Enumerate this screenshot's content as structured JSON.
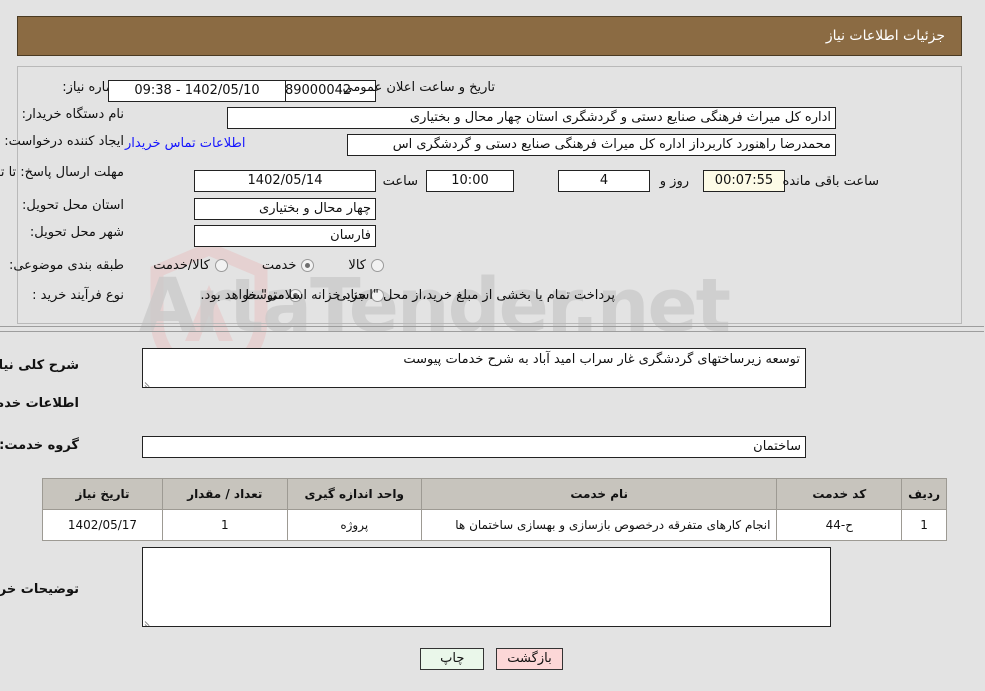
{
  "header": {
    "title": "جزئیات اطلاعات نیاز"
  },
  "form": {
    "need_number_label": "شماره نیاز:",
    "need_number_value": "1102003289000042",
    "announce_label": "تاریخ و ساعت اعلان عمومی:",
    "announce_value": "1402/05/10 - 09:38",
    "buyer_org_label": "نام دستگاه خریدار:",
    "buyer_org_value": "اداره کل میراث فرهنگی  صنایع دستی و گردشگری استان چهار محال و بختیاری",
    "creator_label": "ایجاد کننده درخواست:",
    "creator_value": "محمدرضا راهنورد کاربرداز اداره کل میراث فرهنگی  صنایع دستی و گردشگری اس",
    "contact_link": "اطلاعات تماس خریدار",
    "deadline_label": "مهلت ارسال پاسخ: تا تاریخ:",
    "deadline_date": "1402/05/14",
    "deadline_hour_label": "ساعت",
    "deadline_hour": "10:00",
    "remaining_days": "4",
    "remaining_days_label": "روز و",
    "remaining_timer": "00:07:55",
    "remaining_timer_label": "ساعت باقی مانده",
    "province_label": "استان محل تحویل:",
    "province_value": "چهار محال و بختیاری",
    "city_label": "شهر محل تحویل:",
    "city_value": "فارسان",
    "category_label": "طبقه بندی موضوعی:",
    "category_options": [
      {
        "label": "کالا",
        "selected": false
      },
      {
        "label": "خدمت",
        "selected": true
      },
      {
        "label": "کالا/خدمت",
        "selected": false
      }
    ],
    "process_label": "نوع فرآیند خرید :",
    "process_options": [
      {
        "label": "جزیی",
        "selected": false
      },
      {
        "label": "متوسط",
        "selected": true
      }
    ],
    "payment_note": "پرداخت تمام یا بخشی از مبلغ خرید،از محل \"اسناد خزانه اسلامی\" خواهد بود."
  },
  "description": {
    "label": "شرح کلی نیاز:",
    "value": "توسعه زیرساختهای گردشگری غار سراب امید آباد به شرح خدمات پیوست"
  },
  "services": {
    "section_title": "اطلاعات خدمات مورد نیاز",
    "group_label": "گروه خدمت:",
    "group_value": "ساختمان",
    "table": {
      "columns": [
        "ردیف",
        "کد خدمت",
        "نام خدمت",
        "واحد اندازه گیری",
        "تعداد / مقدار",
        "تاریخ نیاز"
      ],
      "rows": [
        {
          "row": "1",
          "code": "ح-44",
          "name": "انجام کارهای متفرقه درخصوص بازسازی و بهسازی ساختمان ها",
          "unit": "پروژه",
          "quantity": "1",
          "date": "1402/05/17"
        }
      ]
    }
  },
  "buyer_notes": {
    "label": "توضیحات خریدار;",
    "value": ""
  },
  "buttons": {
    "print": "چاپ",
    "back": "بازگشت"
  },
  "watermark": {
    "text": "ArtaTender.net"
  },
  "colors": {
    "header_bg": "#8b6b43",
    "page_bg": "#e3e3e3",
    "link": "#1414ff",
    "table_header": "#c7c4bd",
    "print_btn": "#eaf7ea",
    "back_btn": "#fcd7d7",
    "timer_bg": "#fdfbe7"
  }
}
